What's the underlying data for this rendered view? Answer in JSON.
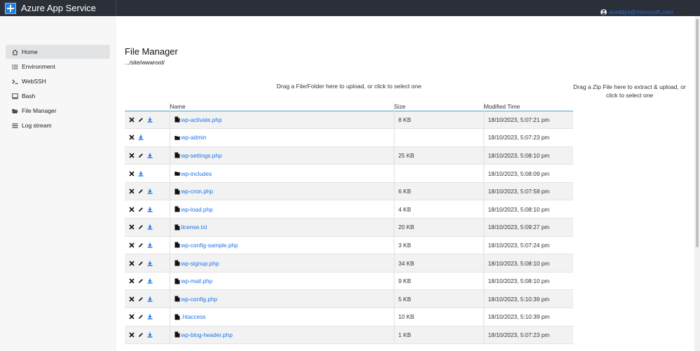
{
  "app": {
    "title": "Azure App Service",
    "user": "areddys@microsoft.com"
  },
  "sidebar": {
    "items": [
      {
        "label": "Home",
        "icon": "home-icon",
        "active": true
      },
      {
        "label": "Environment",
        "icon": "list-icon",
        "active": false
      },
      {
        "label": "WebSSH",
        "icon": "terminal-icon",
        "active": false
      },
      {
        "label": "Bash",
        "icon": "bash-icon",
        "active": false
      },
      {
        "label": "File Manager",
        "icon": "folder-icon",
        "active": false
      },
      {
        "label": "Log stream",
        "icon": "log-icon",
        "active": false
      }
    ]
  },
  "main": {
    "title": "File Manager",
    "path": ".../site/wwwroot/",
    "drop_file_text": "Drag a File/Folder here to upload, or click to select one",
    "drop_zip_text": "Drag a Zip File here to extract & upload, or click to select one",
    "table": {
      "headers": {
        "name": "Name",
        "size": "Size",
        "modified": "Modified Time"
      },
      "rows": [
        {
          "name": "wp-activate.php",
          "type": "file",
          "size": "8 KB",
          "modified": "18/10/2023, 5:07:21 pm"
        },
        {
          "name": "wp-admin",
          "type": "folder",
          "size": "",
          "modified": "18/10/2023, 5:07:23 pm"
        },
        {
          "name": "wp-settings.php",
          "type": "file",
          "size": "25 KB",
          "modified": "18/10/2023, 5:08:10 pm"
        },
        {
          "name": "wp-includes",
          "type": "folder",
          "size": "",
          "modified": "18/10/2023, 5:08:09 pm"
        },
        {
          "name": "wp-cron.php",
          "type": "file",
          "size": "6 KB",
          "modified": "18/10/2023, 5:07:58 pm"
        },
        {
          "name": "wp-load.php",
          "type": "file",
          "size": "4 KB",
          "modified": "18/10/2023, 5:08:10 pm"
        },
        {
          "name": "license.txt",
          "type": "file",
          "size": "20 KB",
          "modified": "18/10/2023, 5:09:27 pm"
        },
        {
          "name": "wp-config-sample.php",
          "type": "file",
          "size": "3 KB",
          "modified": "18/10/2023, 5:07:24 pm"
        },
        {
          "name": "wp-signup.php",
          "type": "file",
          "size": "34 KB",
          "modified": "18/10/2023, 5:08:10 pm"
        },
        {
          "name": "wp-mail.php",
          "type": "file",
          "size": "9 KB",
          "modified": "18/10/2023, 5:08:10 pm"
        },
        {
          "name": "wp-config.php",
          "type": "file",
          "size": "5 KB",
          "modified": "18/10/2023, 5:10:39 pm"
        },
        {
          "name": ".htaccess",
          "type": "file",
          "size": "10 KB",
          "modified": "18/10/2023, 5:10:39 pm"
        },
        {
          "name": "wp-blog-header.php",
          "type": "file",
          "size": "1 KB",
          "modified": "18/10/2023, 5:07:23 pm"
        }
      ]
    }
  },
  "colors": {
    "topbar": "#2b2f38",
    "link": "#1a73e8",
    "accent": "#4ba3d6",
    "sidebar_bg": "#f7f7f7",
    "row_alt": "#f2f2f2"
  }
}
